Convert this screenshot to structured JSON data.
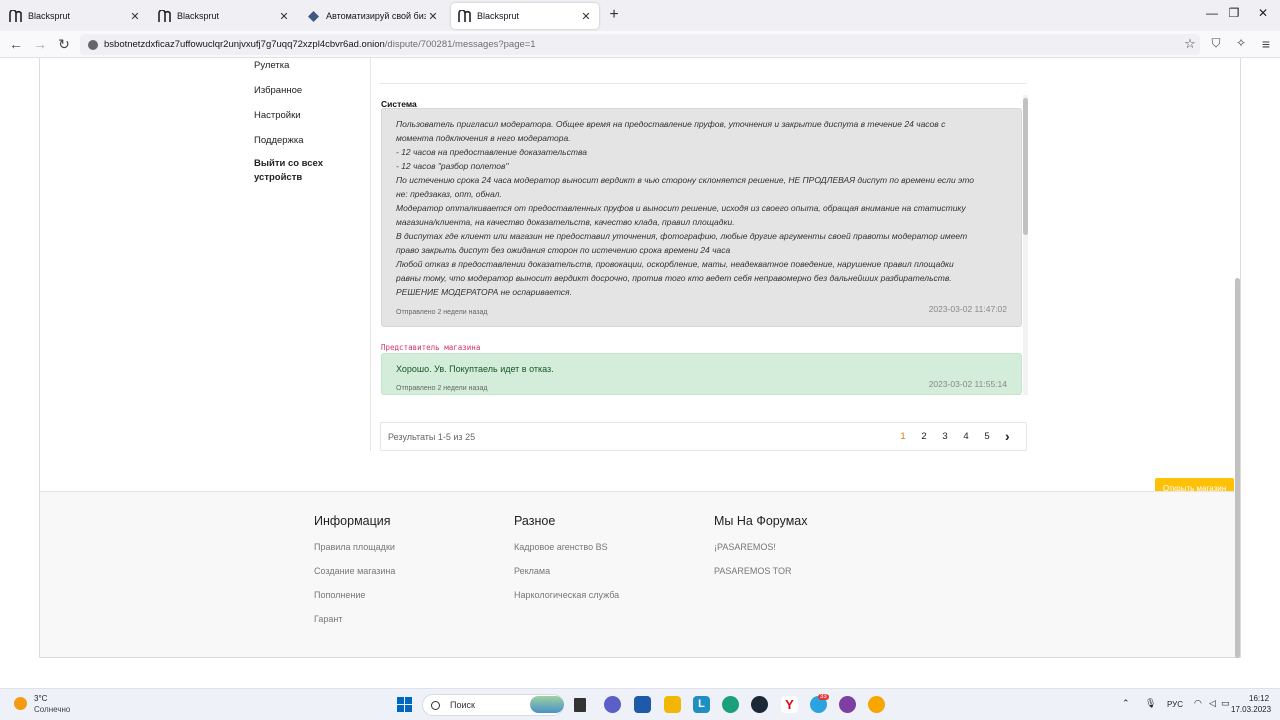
{
  "browser": {
    "tabs": [
      {
        "label": "Blacksprut",
        "active": false
      },
      {
        "label": "Blacksprut",
        "active": false
      },
      {
        "label": "Автоматизируй свой бизнес с",
        "active": false
      },
      {
        "label": "Blacksprut",
        "active": true
      }
    ],
    "url_host": "bsbotnetzdxficaz7uffowuclqr2unjvxufj7g7uqq72xzpl4cbvr6ad.onion",
    "url_path": "/dispute/700281/messages?page=1"
  },
  "sidebar": {
    "items": [
      "Рулетка",
      "Избранное",
      "Настройки",
      "Поддержка"
    ],
    "logout": "Выйти со всех устройств"
  },
  "messages": [
    {
      "author": "Система",
      "lines": [
        "Пользователь пригласил модератора. Общее время на предоставление пруфов, уточнения и закрытие диспута в течение 24 часов с",
        "момента подключения в него модератора.",
        "- 12 часов на предоставление доказательства",
        "- 12 часов \"разбор полетов\"",
        "По истечению срока 24 часа модератор выносит вердикт в чью сторону склоняется решение, НЕ ПРОДЛЕВАЯ диспут по времени если это",
        "не: предзаказ, опт, обнал.",
        "Модератор отталкивается от предоставленных пруфов и выносит решение, исходя из своего опыта, обращая внимание на статистику",
        "магазина/клиента, на качество доказательств, качество клада, правил площадки.",
        "В диспутах где клиент или магазин не предоставил уточнения, фотографию, любые другие аргументы своей правоты модератор имеет",
        "право закрыть диспут без ожидания сторон по истечению срока времени 24 часа",
        "Любой отказ в предоставлении доказательств, провокации, оскорбление, маты, неадекватное поведение, нарушение правил площадки",
        "равны тому, что модератор выносит вердикт досрочно, против того кто ведет себя неправомерно без дальнейших разбирательств.",
        "РЕШЕНИЕ МОДЕРАТОРА не оспаривается."
      ],
      "sent": "Отправлено 2 недели назад",
      "time": "2023-03-02 11:47:02"
    },
    {
      "author": "Представитель магазина",
      "text": "Хорошо. Ув. Покуптаель идет в отказ.",
      "sent": "Отправлено 2 недели назад",
      "time": "2023-03-02 11:55:14"
    }
  ],
  "pagination": {
    "results": "Результаты 1-5 из 25",
    "pages": [
      "1",
      "2",
      "3",
      "4",
      "5"
    ],
    "current": "1",
    "next_icon": "chevron-right-icon"
  },
  "open_shop_label": "Открыть магазин",
  "footer": {
    "columns": [
      {
        "title": "Информация",
        "links": [
          "Правила площадки",
          "Создание магазина",
          "Пополнение",
          "Гарант"
        ]
      },
      {
        "title": "Разное",
        "links": [
          "Кадровое агенство BS",
          "Реклама",
          "Наркологическая служба"
        ]
      },
      {
        "title": "Мы На Форумах",
        "links": [
          "¡PASAREMOS!",
          "PASAREMOS TOR"
        ]
      }
    ]
  },
  "taskbar": {
    "weather_temp": "3°C",
    "weather_desc": "Солнечно",
    "search_label": "Поиск",
    "lang": "РУС",
    "time": "16:12",
    "date": "17.03.2023",
    "badge": "33"
  },
  "colors": {
    "system_bg": "#e4e4e4",
    "shop_bg": "#d4edda",
    "shop_author": "#d6336c",
    "accent": "#ffc107",
    "current_page": "#e07b00"
  }
}
